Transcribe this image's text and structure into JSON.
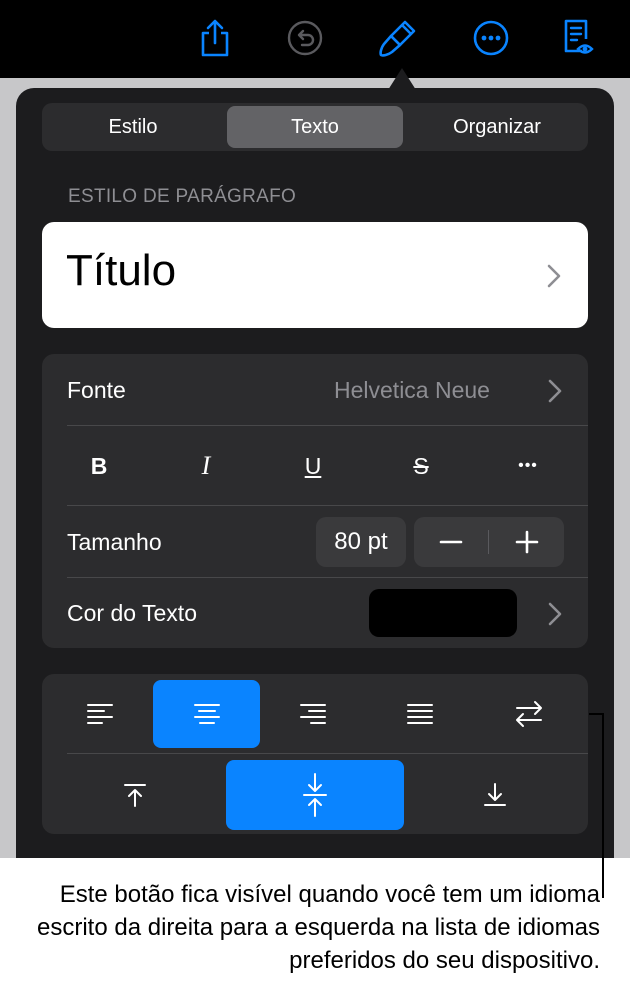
{
  "colors": {
    "accent": "#0a84ff",
    "panel": "#1c1c1e",
    "toolbar_icon": "#0a84ff"
  },
  "toolbar": {
    "icons": [
      "share-icon",
      "undo-icon",
      "format-paintbrush-icon",
      "more-icon",
      "reader-view-icon"
    ]
  },
  "tabs": [
    "Estilo",
    "Texto",
    "Organizar"
  ],
  "active_tab": "Texto",
  "paragraph_style": {
    "section_label": "ESTILO DE PARÁGRAFO",
    "value": "Título"
  },
  "font": {
    "label": "Fonte",
    "value": "Helvetica Neue"
  },
  "format_buttons": {
    "bold": "B",
    "italic": "I",
    "underline": "U",
    "strikethrough": "S",
    "more": "•••"
  },
  "size": {
    "label": "Tamanho",
    "value": "80 pt",
    "decrement": "−",
    "increment": "+"
  },
  "text_color": {
    "label": "Cor do Texto",
    "value": "#000000"
  },
  "alignment": {
    "horizontal": [
      "align-left",
      "align-center",
      "align-right",
      "justify",
      "rtl-direction"
    ],
    "horizontal_selected": "align-center",
    "vertical": [
      "align-top",
      "align-middle",
      "align-bottom"
    ],
    "vertical_selected": "align-middle"
  },
  "caption": "Este botão fica visível quando você tem um idioma escrito da direita para a esquerda na lista de idiomas preferidos do seu dispositivo."
}
